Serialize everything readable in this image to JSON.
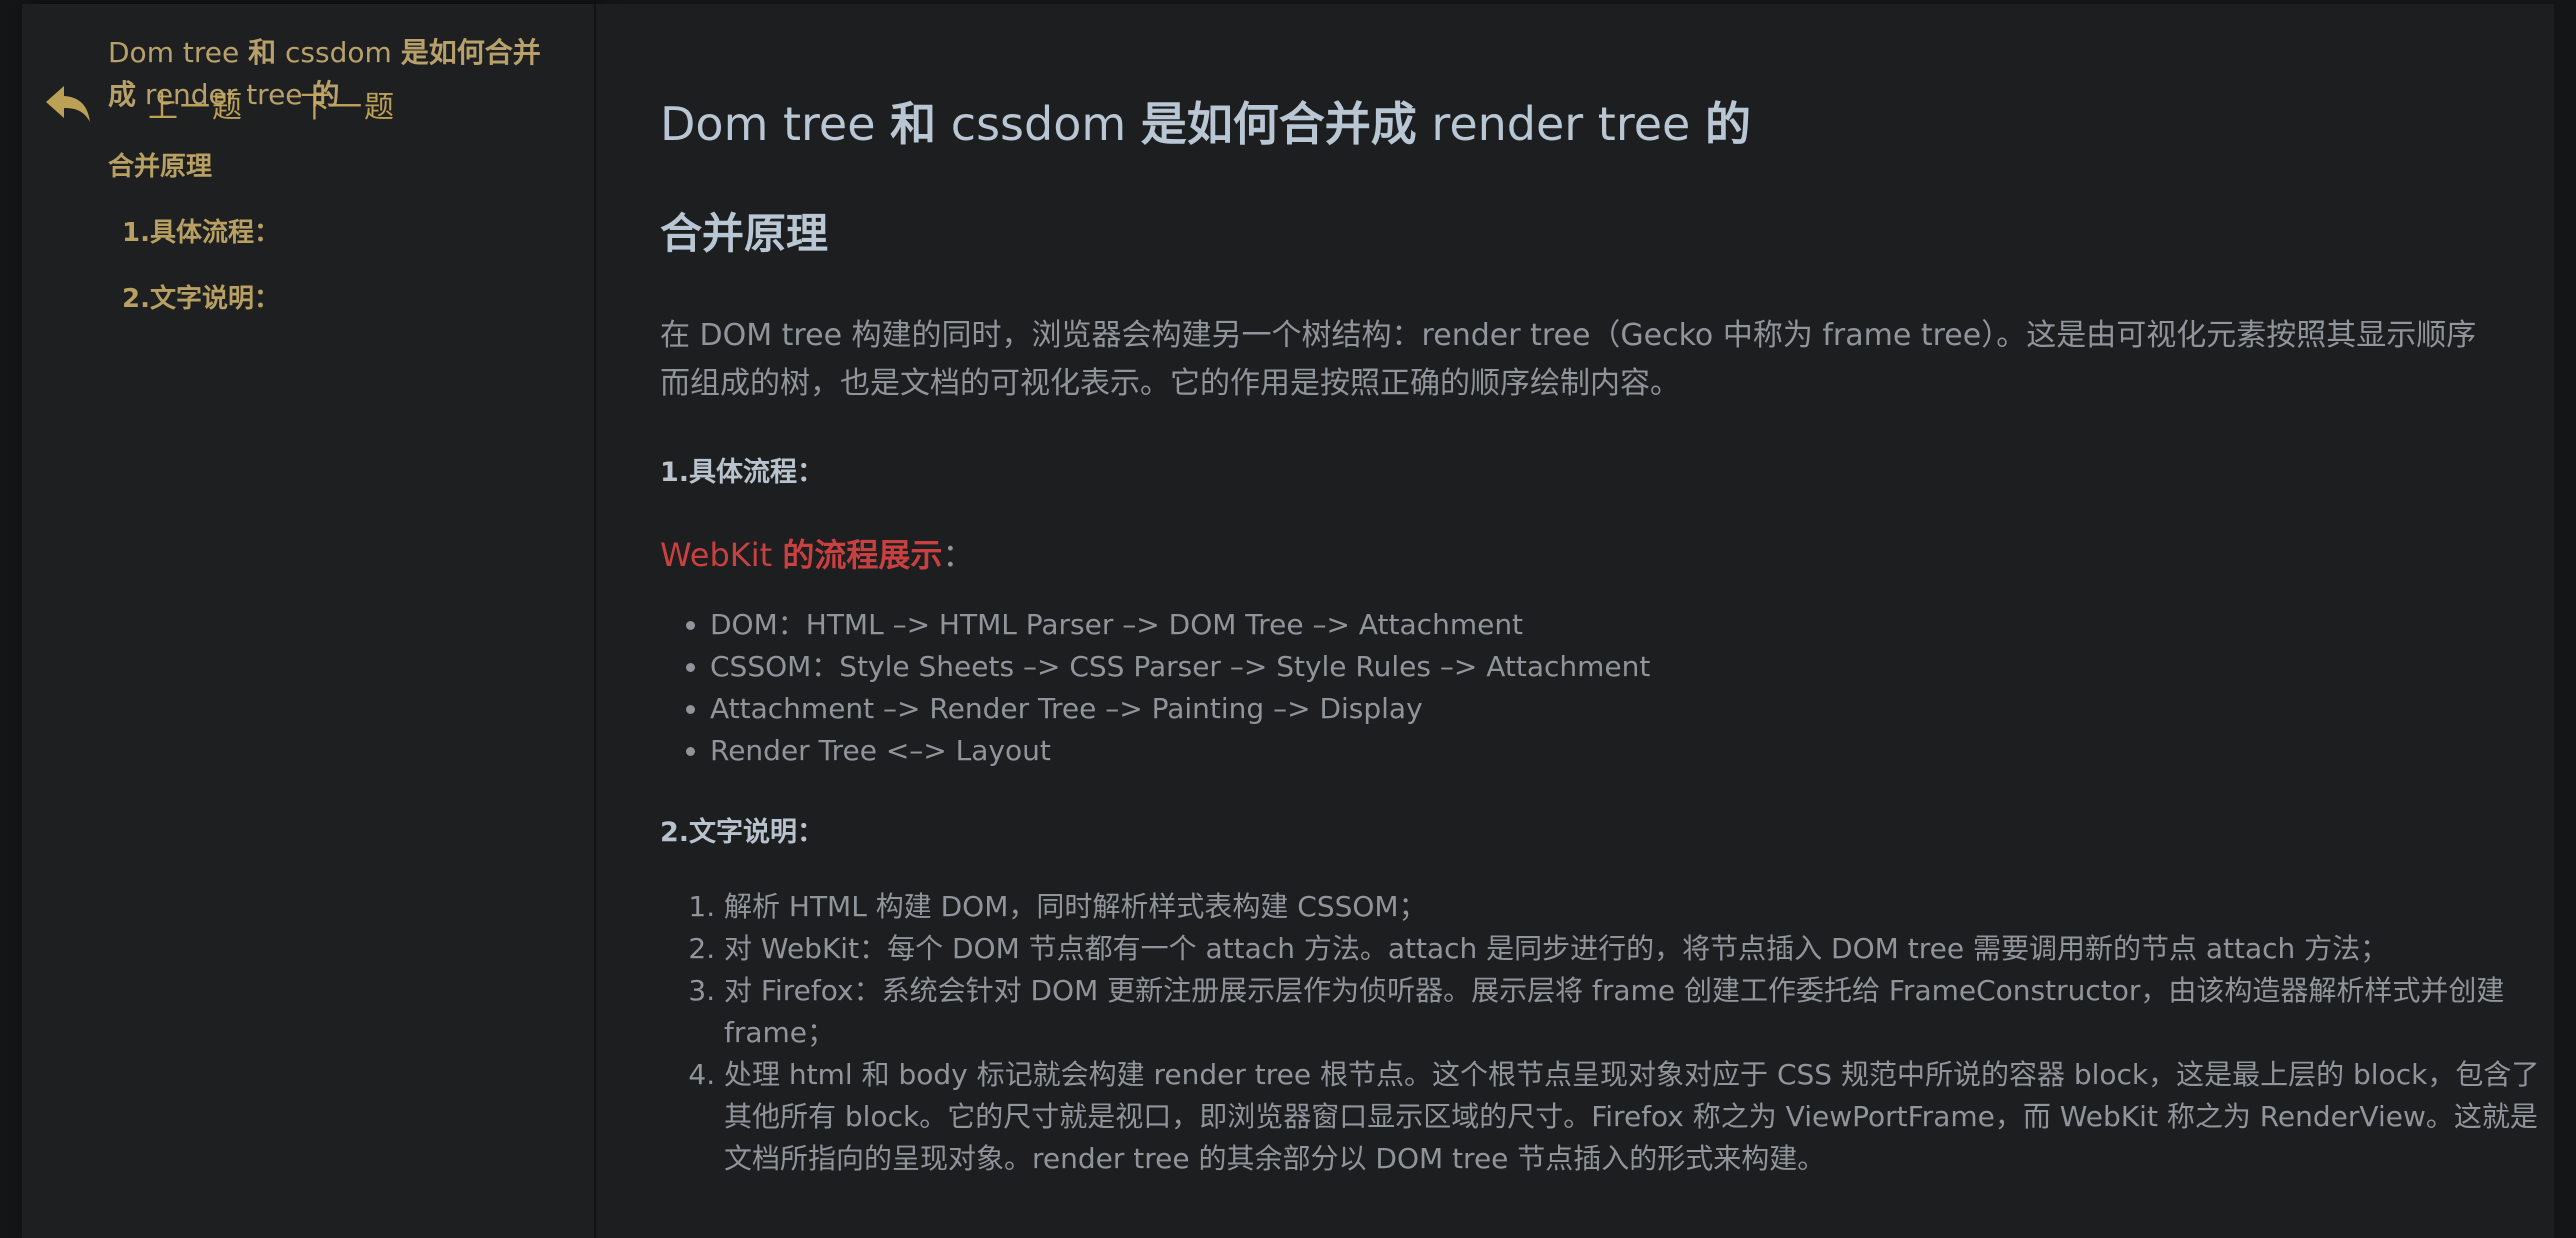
{
  "sidebar": {
    "title_parts": [
      "Dom tree ",
      "和",
      " cssdom ",
      "是如何合并成",
      " render tree ",
      "的"
    ],
    "nav": {
      "prev_label": "上一题",
      "next_label": "下一题"
    },
    "toc": [
      {
        "label": "合并原理"
      },
      {
        "label": "1.具体流程："
      },
      {
        "label": "2.文字说明："
      }
    ]
  },
  "article": {
    "title_parts": [
      "Dom tree ",
      "和",
      " cssdom ",
      "是如何合并成",
      " render tree ",
      "的"
    ],
    "section_heading": "合并原理",
    "intro": "在 DOM tree 构建的同时，浏览器会构建另一个树结构：render tree（Gecko 中称为 frame tree）。这是由可视化元素按照其显示顺序而组成的树，也是文档的可视化表示。它的作用是按照正确的顺序绘制内容。",
    "flow_heading": "1.具体流程：",
    "webkit_prefix": "WebKit ",
    "webkit_bold": "的流程展示",
    "webkit_suffix": "：",
    "flow_steps": [
      "DOM：HTML –> HTML Parser –> DOM Tree –> Attachment",
      "CSSOM：Style Sheets –> CSS Parser –> Style Rules –> Attachment",
      "Attachment –> Render Tree –> Painting –> Display",
      "Render Tree <–> Layout"
    ],
    "desc_heading": "2.文字说明：",
    "desc_items": [
      "解析 HTML 构建 DOM，同时解析样式表构建 CSSOM；",
      "对 WebKit：每个 DOM 节点都有一个 attach 方法。attach 是同步进行的，将节点插入 DOM tree 需要调用新的节点 attach 方法；",
      "对 Firefox：系统会针对 DOM 更新注册展示层作为侦听器。展示层将 frame 创建工作委托给 FrameConstructor，由该构造器解析样式并创建 frame；",
      "处理 html 和 body 标记就会构建 render tree 根节点。这个根节点呈现对象对应于 CSS 规范中所说的容器 block，这是最上层的 block，包含了其他所有 block。它的尺寸就是视口，即浏览器窗口显示区域的尺寸。Firefox 称之为 ViewPortFrame，而 WebKit 称之为 RenderView。这就是文档所指向的呈现对象。render tree 的其余部分以 DOM tree 节点插入的形式来构建。"
    ]
  },
  "colors": {
    "sidebar_text": "#b8a06a",
    "heading": "#b9c6d3",
    "body_text": "#8f959b",
    "accent_red": "#c8403f"
  },
  "icons": {
    "back": "reply-arrow-icon"
  }
}
